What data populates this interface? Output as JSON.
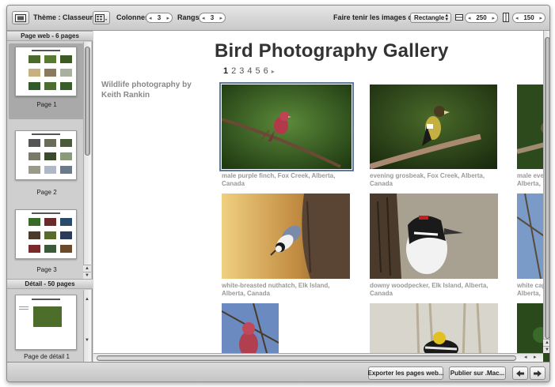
{
  "toolbar": {
    "theme_label": "Thème : Classeur",
    "columns_label": "Colonnes :",
    "columns_value": "3",
    "rows_label": "Rangs :",
    "rows_value": "3",
    "fit_label": "Faire tenir les images dans :",
    "fit_option": "Rectangle",
    "width_value": "250",
    "height_value": "150"
  },
  "sidebar": {
    "web_pages_header": "Page web - 6 pages",
    "pages": [
      {
        "label": "Page 1",
        "selected": true
      },
      {
        "label": "Page 2",
        "selected": false
      },
      {
        "label": "Page 3",
        "selected": false
      }
    ],
    "detail_header": "Détail - 50 pages",
    "detail_pages": [
      {
        "label": "Page de détail 1"
      }
    ]
  },
  "main": {
    "title": "Bird Photography Gallery",
    "pager": {
      "current": "1",
      "others": [
        "2",
        "3",
        "4",
        "5",
        "6"
      ],
      "next_glyph": "▸"
    },
    "subtitle": "Wildlife photography by Keith Rankin",
    "photos": [
      {
        "caption": "male purple finch, Fox Creek, Alberta, Canada",
        "bird": "purple-finch"
      },
      {
        "caption": "evening grosbeak, Fox Creek, Alberta, Canada",
        "bird": "evening-grosbeak"
      },
      {
        "caption": "male eve",
        "caption2": "Alberta,",
        "bird": "partial"
      },
      {
        "caption": "white-breasted nuthatch, Elk Island, Alberta, Canada",
        "bird": "nuthatch"
      },
      {
        "caption": "downy woodpecker, Elk Island, Alberta, Canada",
        "bird": "woodpecker"
      },
      {
        "caption": "white cap",
        "caption2": "Alberta,",
        "bird": "partial"
      }
    ]
  },
  "bottom": {
    "export_label": "Exporter les pages web...",
    "publish_label": "Publier sur .Mac..."
  },
  "colors": {
    "selection_outline": "#5d7b9d",
    "title": "#333333",
    "caption": "#999999"
  }
}
